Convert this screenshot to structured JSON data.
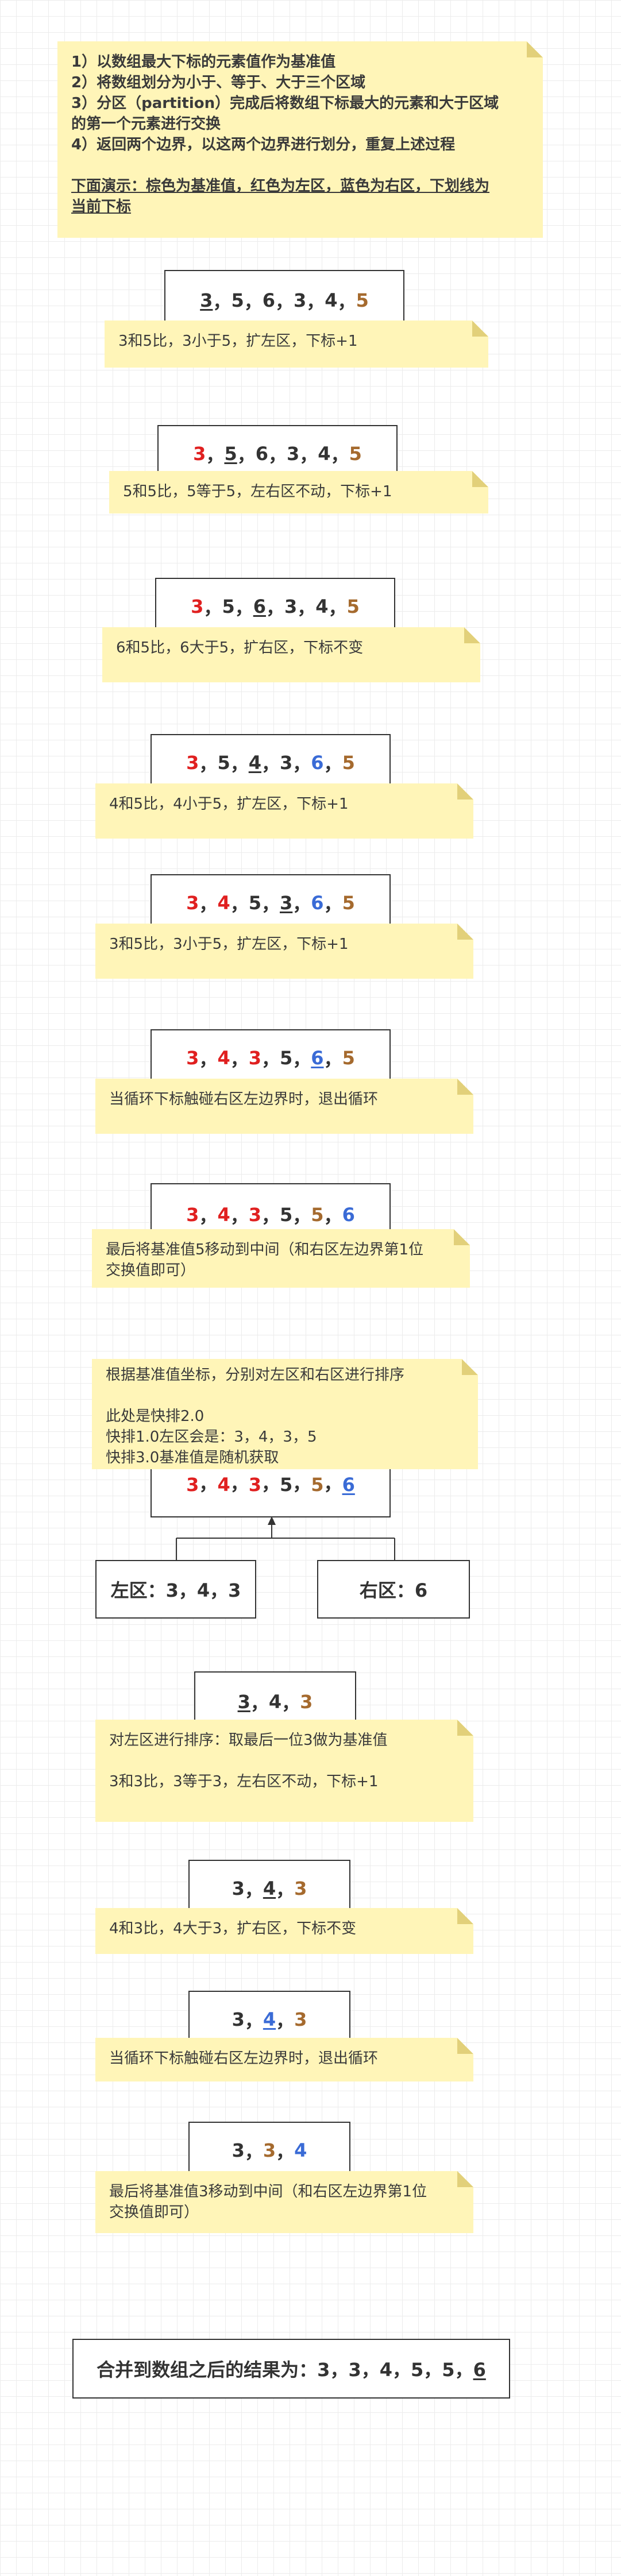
{
  "intro": {
    "lines": [
      "1）以数组最大下标的元素值作为基准值",
      "2）将数组划分为小于、等于、大于三个区域",
      "3）分区（partition）完成后将数组下标最大的元素和大于区域",
      "的第一个元素进行交换",
      "4）返回两个边界，以这两个边界进行划分，重复上述过程",
      "",
      "下面演示：棕色为基准值，红色为左区，蓝色为右区，下划线为",
      "当前下标"
    ]
  },
  "colors": {
    "pivot": "#a56a2e",
    "left": "#e02020",
    "right": "#3a6bd6",
    "note_bg": "#fff5b8"
  },
  "steps": [
    {
      "array": [
        {
          "v": "3",
          "c": "n",
          "u": true
        },
        {
          "v": "5",
          "c": "n"
        },
        {
          "v": "6",
          "c": "n"
        },
        {
          "v": "3",
          "c": "n"
        },
        {
          "v": "4",
          "c": "n"
        },
        {
          "v": "5",
          "c": "o"
        }
      ],
      "note": [
        "3和5比，3小于5，扩左区，下标+1"
      ]
    },
    {
      "array": [
        {
          "v": "3",
          "c": "r"
        },
        {
          "v": "5",
          "c": "n",
          "u": true
        },
        {
          "v": "6",
          "c": "n"
        },
        {
          "v": "3",
          "c": "n"
        },
        {
          "v": "4",
          "c": "n"
        },
        {
          "v": "5",
          "c": "o"
        }
      ],
      "note": [
        "5和5比，5等于5，左右区不动，下标+1"
      ]
    },
    {
      "array": [
        {
          "v": "3",
          "c": "r"
        },
        {
          "v": "5",
          "c": "n"
        },
        {
          "v": "6",
          "c": "n",
          "u": true
        },
        {
          "v": "3",
          "c": "n"
        },
        {
          "v": "4",
          "c": "n"
        },
        {
          "v": "5",
          "c": "o"
        }
      ],
      "note": [
        "6和5比，6大于5，扩右区，下标不变"
      ]
    },
    {
      "array": [
        {
          "v": "3",
          "c": "r"
        },
        {
          "v": "5",
          "c": "n"
        },
        {
          "v": "4",
          "c": "n",
          "u": true
        },
        {
          "v": "3",
          "c": "n"
        },
        {
          "v": "6",
          "c": "b"
        },
        {
          "v": "5",
          "c": "o"
        }
      ],
      "note": [
        "4和5比，4小于5，扩左区，下标+1"
      ]
    },
    {
      "array": [
        {
          "v": "3",
          "c": "r"
        },
        {
          "v": "4",
          "c": "r"
        },
        {
          "v": "5",
          "c": "n"
        },
        {
          "v": "3",
          "c": "n",
          "u": true
        },
        {
          "v": "6",
          "c": "b"
        },
        {
          "v": "5",
          "c": "o"
        }
      ],
      "note": [
        "3和5比，3小于5，扩左区，下标+1"
      ]
    },
    {
      "array": [
        {
          "v": "3",
          "c": "r"
        },
        {
          "v": "4",
          "c": "r"
        },
        {
          "v": "3",
          "c": "r"
        },
        {
          "v": "5",
          "c": "n"
        },
        {
          "v": "6",
          "c": "b",
          "u": true
        },
        {
          "v": "5",
          "c": "o"
        }
      ],
      "note": [
        "当循环下标触碰右区左边界时，退出循环"
      ]
    },
    {
      "array": [
        {
          "v": "3",
          "c": "r"
        },
        {
          "v": "4",
          "c": "r"
        },
        {
          "v": "3",
          "c": "r"
        },
        {
          "v": "5",
          "c": "n"
        },
        {
          "v": "5",
          "c": "o"
        },
        {
          "v": "6",
          "c": "b"
        }
      ],
      "note": [
        "最后将基准值5移动到中间（和右区左边界第1位",
        "交换值即可）"
      ]
    }
  ],
  "split": {
    "note": [
      "根据基准值坐标，分别对左区和右区进行排序",
      "",
      "此处是快排2.0",
      "快排1.0左区会是：3，4，3，5",
      "快排3.0基准值是随机获取"
    ],
    "array": [
      {
        "v": "3",
        "c": "r"
      },
      {
        "v": "4",
        "c": "r"
      },
      {
        "v": "3",
        "c": "r"
      },
      {
        "v": "5",
        "c": "n"
      },
      {
        "v": "5",
        "c": "o"
      },
      {
        "v": "6",
        "c": "b",
        "u": true
      }
    ],
    "left_label": "左区：3，4，3",
    "right_label": "右区：6"
  },
  "left_steps": [
    {
      "array": [
        {
          "v": "3",
          "c": "n",
          "u": true
        },
        {
          "v": "4",
          "c": "n"
        },
        {
          "v": "3",
          "c": "o"
        }
      ],
      "note": [
        "对左区进行排序：取最后一位3做为基准值",
        "",
        "3和3比，3等于3，左右区不动，下标+1"
      ]
    },
    {
      "array": [
        {
          "v": "3",
          "c": "n"
        },
        {
          "v": "4",
          "c": "n",
          "u": true
        },
        {
          "v": "3",
          "c": "o"
        }
      ],
      "note": [
        "4和3比，4大于3，扩右区，下标不变"
      ]
    },
    {
      "array": [
        {
          "v": "3",
          "c": "n"
        },
        {
          "v": "4",
          "c": "b",
          "u": true
        },
        {
          "v": "3",
          "c": "o"
        }
      ],
      "note": [
        "当循环下标触碰右区左边界时，退出循环"
      ]
    },
    {
      "array": [
        {
          "v": "3",
          "c": "n"
        },
        {
          "v": "3",
          "c": "o"
        },
        {
          "v": "4",
          "c": "b"
        }
      ],
      "note": [
        "最后将基准值3移动到中间（和右区左边界第1位",
        "交换值即可）"
      ]
    }
  ],
  "result": {
    "prefix": "合并到数组之后的结果为：",
    "array": [
      {
        "v": "3",
        "c": "n"
      },
      {
        "v": "3",
        "c": "n"
      },
      {
        "v": "4",
        "c": "n"
      },
      {
        "v": "5",
        "c": "n"
      },
      {
        "v": "5",
        "c": "n"
      },
      {
        "v": "6",
        "c": "n",
        "u": true
      }
    ]
  }
}
